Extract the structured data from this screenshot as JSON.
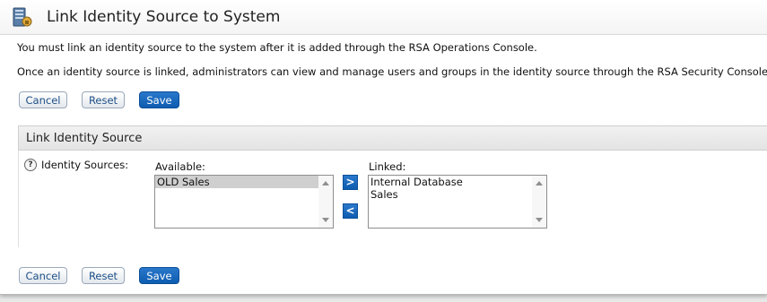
{
  "page": {
    "title": "Link Identity Source to System",
    "description_1": "You must link an identity source to the system after it is added through the RSA Operations Console.",
    "description_2": "Once an identity source is linked, administrators can view and manage users and groups in the identity source through the RSA Security Console."
  },
  "buttons": {
    "cancel": "Cancel",
    "reset": "Reset",
    "save": "Save"
  },
  "section": {
    "title": "Link Identity Source",
    "field_label": "Identity Sources:",
    "help_glyph": "?"
  },
  "available": {
    "label": "Available:",
    "items": [
      "OLD Sales"
    ],
    "selected": "OLD Sales"
  },
  "linked": {
    "label": "Linked:",
    "items": [
      "Internal Database",
      "Sales"
    ]
  },
  "move": {
    "add": ">",
    "remove": "<"
  },
  "colors": {
    "primary_button": "#0d5cb0",
    "secondary_button_text": "#1d4f86",
    "section_header": "#e8e8e8",
    "selection": "#cfcfcf"
  },
  "icons": {
    "title_icon": "identity-source-server-icon",
    "help_icon": "help-icon",
    "scroll_up": "scroll-up-arrow-icon",
    "scroll_down": "scroll-down-arrow-icon"
  }
}
